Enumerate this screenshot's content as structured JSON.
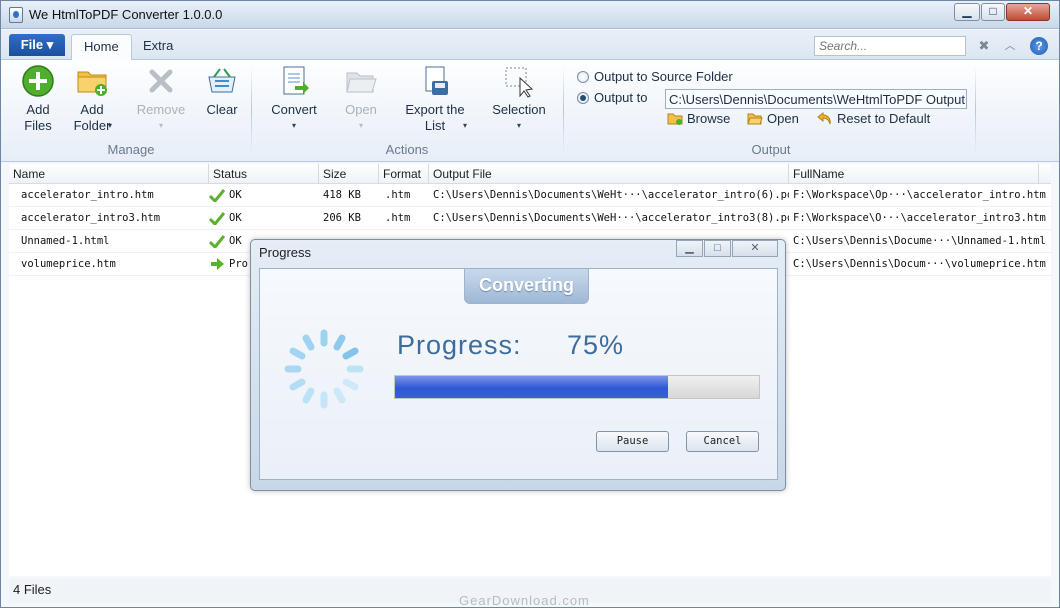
{
  "window": {
    "title": "We HtmlToPDF Converter 1.0.0.0",
    "min": "▁",
    "max": "□",
    "close": "✕"
  },
  "tabs": {
    "file": "File ▾",
    "home": "Home",
    "extra": "Extra"
  },
  "search": {
    "placeholder": "Search..."
  },
  "ribbon": {
    "manage": {
      "label": "Manage",
      "add_files": "Add Files",
      "add_folder": "Add Folder",
      "remove": "Remove",
      "clear": "Clear"
    },
    "actions": {
      "label": "Actions",
      "convert": "Convert",
      "open": "Open",
      "export": "Export the List",
      "selection": "Selection"
    },
    "output": {
      "label": "Output",
      "to_source": "Output to Source Folder",
      "to_path": "Output to",
      "path": "C:\\Users\\Dennis\\Documents\\WeHtmlToPDF Output",
      "browse": "Browse",
      "open": "Open",
      "reset": "Reset to Default"
    }
  },
  "table": {
    "headers": {
      "name": "Name",
      "status": "Status",
      "size": "Size",
      "format": "Format",
      "output": "Output File",
      "fullname": "FullName"
    },
    "rows": [
      {
        "name": "accelerator_intro.htm",
        "status": "OK",
        "size": "418 KB",
        "format": ".htm",
        "output": "C:\\Users\\Dennis\\Documents\\WeHt···\\accelerator_intro(6).pdf",
        "fullname": "F:\\Workspace\\Op···\\accelerator_intro.htm"
      },
      {
        "name": "accelerator_intro3.htm",
        "status": "OK",
        "size": "206 KB",
        "format": ".htm",
        "output": "C:\\Users\\Dennis\\Documents\\WeH···\\accelerator_intro3(8).pdf",
        "fullname": "F:\\Workspace\\O···\\accelerator_intro3.htm"
      },
      {
        "name": "Unnamed-1.html",
        "status": "OK",
        "size": "",
        "format": "",
        "output": "",
        "fullname": "C:\\Users\\Dennis\\Docume···\\Unnamed-1.html"
      },
      {
        "name": "volumeprice.htm",
        "status": "Pro",
        "size": "",
        "format": "",
        "output": "",
        "fullname": "C:\\Users\\Dennis\\Docum···\\volumeprice.htm"
      }
    ]
  },
  "statusbar": {
    "text": "4 Files"
  },
  "watermark": "GearDownload.com",
  "dialog": {
    "title": "Progress",
    "banner": "Converting",
    "progress_label": "Progress:",
    "progress_value": "75%",
    "progress_fraction": 0.75,
    "pause": "Pause",
    "cancel": "Cancel"
  },
  "colors": {
    "accent": "#1b4f9e",
    "progress": "#2f58d5",
    "ok_check": "#5ab22a"
  }
}
